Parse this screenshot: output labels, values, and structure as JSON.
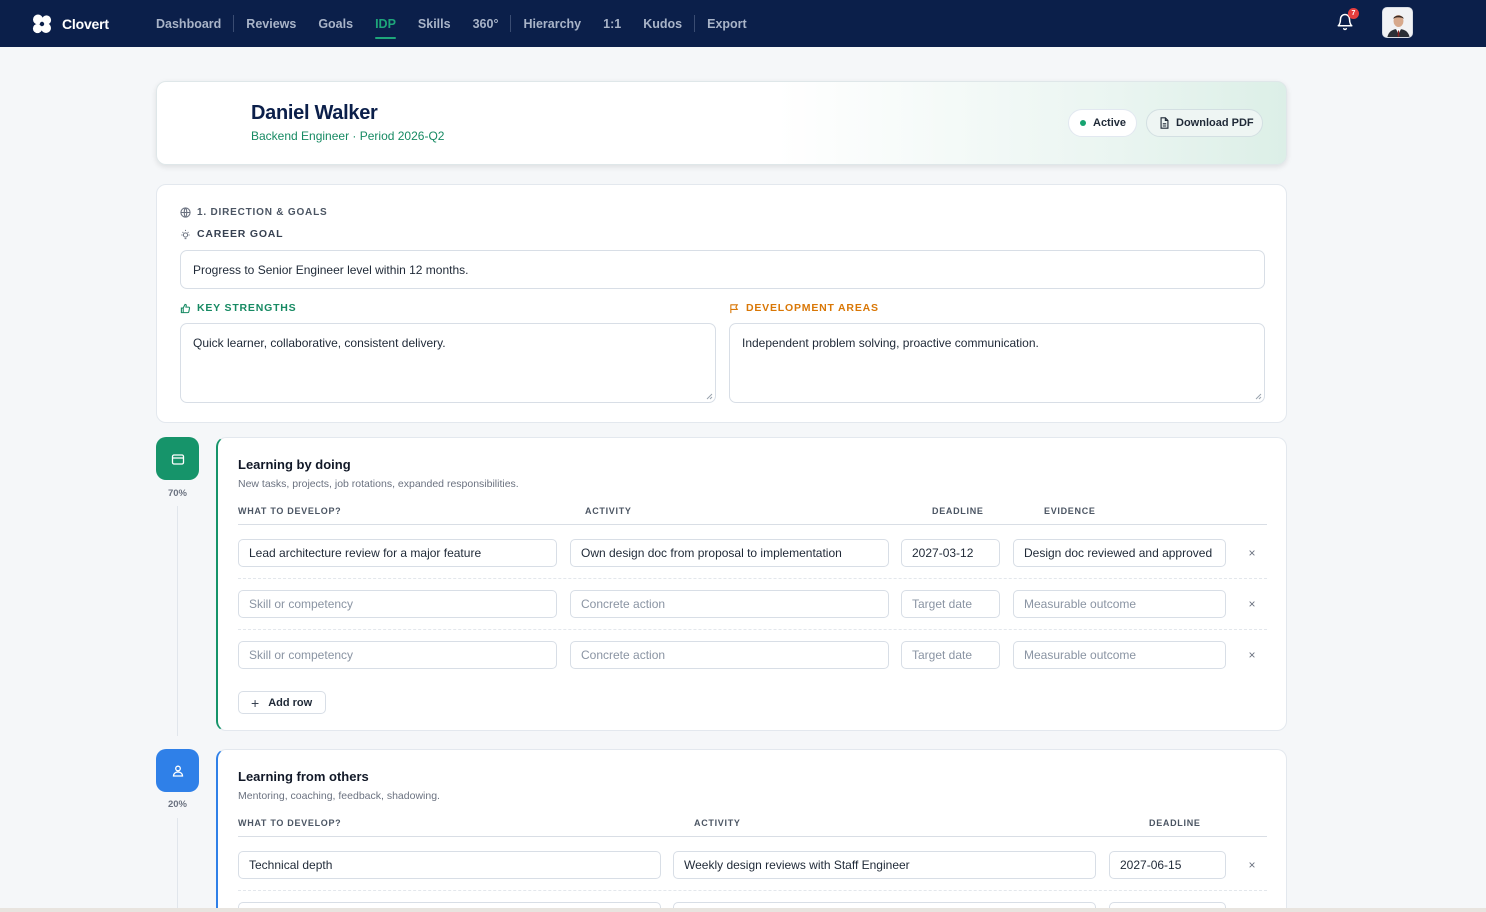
{
  "app": {
    "name": "Clovert"
  },
  "nav": {
    "items": [
      "Dashboard",
      "Reviews",
      "Goals",
      "IDP",
      "Skills",
      "360°",
      "Hierarchy",
      "1:1",
      "Kudos",
      "Export"
    ],
    "active": "IDP",
    "notifications": "7"
  },
  "header": {
    "name": "Daniel Walker",
    "subtitle": "Backend Engineer · Period 2026-Q2",
    "status": "Active",
    "download": "Download PDF"
  },
  "direction": {
    "section_title": "1. DIRECTION & GOALS",
    "career_label": "CAREER GOAL",
    "career_value": "Progress to Senior Engineer level within 12 months.",
    "strengths_label": "KEY STRENGTHS",
    "strengths_value": "Quick learner, collaborative, consistent delivery.",
    "dev_label": "DEVELOPMENT AREAS",
    "dev_value": "Independent problem solving, proactive communication."
  },
  "doing": {
    "percent": "70%",
    "title": "Learning by doing",
    "subtitle": "New tasks, projects, job rotations, expanded responsibilities.",
    "columns": [
      "WHAT TO DEVELOP?",
      "ACTIVITY",
      "DEADLINE",
      "EVIDENCE"
    ],
    "rows": [
      {
        "skill": "Lead architecture review for a major feature",
        "activity": "Own design doc from proposal to implementation",
        "deadline": "2027-03-12",
        "evidence": "Design doc reviewed and approved"
      },
      {
        "skill": "",
        "activity": "",
        "deadline": "",
        "evidence": ""
      },
      {
        "skill": "",
        "activity": "",
        "deadline": "",
        "evidence": ""
      }
    ],
    "placeholders": {
      "skill": "Skill or competency",
      "activity": "Concrete action",
      "deadline": "Target date",
      "evidence": "Measurable outcome"
    },
    "add_row": "Add row",
    "remove": "×"
  },
  "others": {
    "percent": "20%",
    "title": "Learning from others",
    "subtitle": "Mentoring, coaching, feedback, shadowing.",
    "columns": [
      "WHAT TO DEVELOP?",
      "ACTIVITY",
      "DEADLINE"
    ],
    "rows": [
      {
        "skill": "Technical depth",
        "activity": "Weekly design reviews with Staff Engineer",
        "deadline": "2027-06-15"
      }
    ],
    "remove": "×"
  },
  "colors": {
    "nav_bg": "#0b1f4a",
    "accent_green": "#16946a",
    "accent_blue": "#2f80e8",
    "warning": "#d97706"
  }
}
